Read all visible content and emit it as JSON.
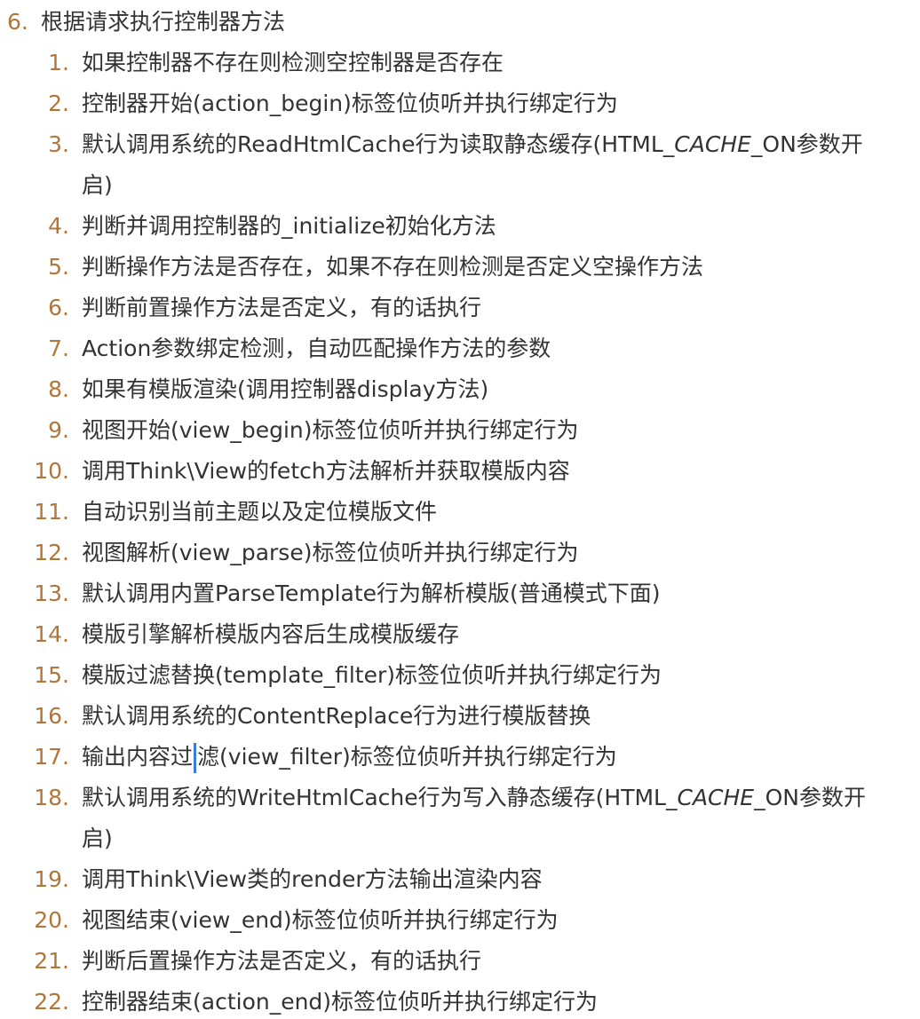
{
  "outer": {
    "marker": "6.",
    "text": "根据请求执行控制器方法"
  },
  "items": [
    {
      "num": "1.",
      "text": "如果控制器不存在则检测空控制器是否存在"
    },
    {
      "num": "2.",
      "text": "控制器开始(action_begin)标签位侦听并执行绑定行为"
    },
    {
      "num": "3.",
      "pre": "默认调用系统的ReadHtmlCache行为读取静态缓存(HTML_",
      "ital": "CACHE",
      "post": "_ON参数开启)"
    },
    {
      "num": "4.",
      "text": "判断并调用控制器的_initialize初始化方法"
    },
    {
      "num": "5.",
      "text": "判断操作方法是否存在，如果不存在则检测是否定义空操作方法"
    },
    {
      "num": "6.",
      "text": "判断前置操作方法是否定义，有的话执行"
    },
    {
      "num": "7.",
      "text": "Action参数绑定检测，自动匹配操作方法的参数"
    },
    {
      "num": "8.",
      "text": "如果有模版渲染(调用控制器display方法)"
    },
    {
      "num": "9.",
      "text": "视图开始(view_begin)标签位侦听并执行绑定行为"
    },
    {
      "num": "10.",
      "text": "调用Think\\View的fetch方法解析并获取模版内容"
    },
    {
      "num": "11.",
      "text": "自动识别当前主题以及定位模版文件"
    },
    {
      "num": "12.",
      "text": "视图解析(view_parse)标签位侦听并执行绑定行为"
    },
    {
      "num": "13.",
      "text": "默认调用内置ParseTemplate行为解析模版(普通模式下面)"
    },
    {
      "num": "14.",
      "text": "模版引擎解析模版内容后生成模版缓存"
    },
    {
      "num": "15.",
      "text": "模版过滤替换(template_filter)标签位侦听并执行绑定行为"
    },
    {
      "num": "16.",
      "text": "默认调用系统的ContentReplace行为进行模版替换"
    },
    {
      "num": "17.",
      "pre": "输出内容过",
      "post": "滤(view_filter)标签位侦听并执行绑定行为",
      "cursor": true
    },
    {
      "num": "18.",
      "pre": "默认调用系统的WriteHtmlCache行为写入静态缓存(HTML_",
      "ital": "CACHE",
      "post": "_ON参数开启)"
    },
    {
      "num": "19.",
      "text": "调用Think\\View类的render方法输出渲染内容"
    },
    {
      "num": "20.",
      "text": "视图结束(view_end)标签位侦听并执行绑定行为"
    },
    {
      "num": "21.",
      "text": "判断后置操作方法是否定义，有的话执行"
    },
    {
      "num": "22.",
      "text": "控制器结束(action_end)标签位侦听并执行绑定行为"
    }
  ],
  "colors": {
    "marker": "#b3763a",
    "text": "#333333",
    "cursor": "#3d7bd6"
  }
}
